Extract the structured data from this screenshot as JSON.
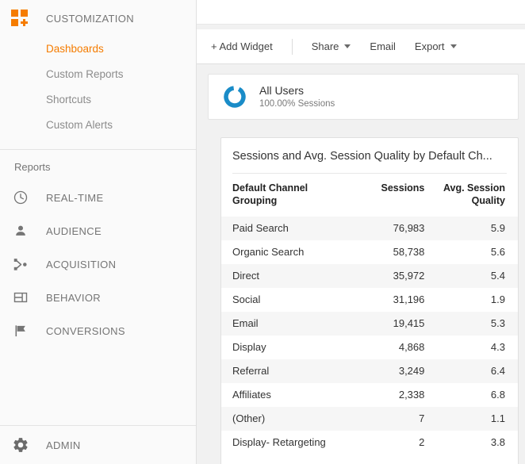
{
  "sidebar": {
    "customization": {
      "label": "CUSTOMIZATION",
      "icon": "customization-grid-icon"
    },
    "sub_items": [
      {
        "label": "Dashboards",
        "active": true
      },
      {
        "label": "Custom Reports",
        "active": false
      },
      {
        "label": "Shortcuts",
        "active": false
      },
      {
        "label": "Custom Alerts",
        "active": false
      }
    ],
    "reports_label": "Reports",
    "nav_items": [
      {
        "label": "REAL-TIME",
        "icon": "clock-icon"
      },
      {
        "label": "AUDIENCE",
        "icon": "person-icon"
      },
      {
        "label": "ACQUISITION",
        "icon": "share-network-icon"
      },
      {
        "label": "BEHAVIOR",
        "icon": "layout-panels-icon"
      },
      {
        "label": "CONVERSIONS",
        "icon": "flag-icon"
      }
    ],
    "admin": {
      "label": "ADMIN",
      "icon": "gear-icon"
    }
  },
  "toolbar": {
    "add_widget": "+ Add Widget",
    "share": "Share",
    "email": "Email",
    "export": "Export"
  },
  "segment": {
    "title": "All Users",
    "subtitle": "100.00% Sessions",
    "donut_color": "#1a8cc8"
  },
  "widget": {
    "title": "Sessions and Avg. Session Quality by Default Ch...",
    "columns": [
      "Default Channel Grouping",
      "Sessions",
      "Avg. Session Quality"
    ],
    "rows": [
      {
        "channel": "Paid Search",
        "sessions": "76,983",
        "quality": "5.9"
      },
      {
        "channel": "Organic Search",
        "sessions": "58,738",
        "quality": "5.6"
      },
      {
        "channel": "Direct",
        "sessions": "35,972",
        "quality": "5.4"
      },
      {
        "channel": "Social",
        "sessions": "31,196",
        "quality": "1.9"
      },
      {
        "channel": "Email",
        "sessions": "19,415",
        "quality": "5.3"
      },
      {
        "channel": "Display",
        "sessions": "4,868",
        "quality": "4.3"
      },
      {
        "channel": "Referral",
        "sessions": "3,249",
        "quality": "6.4"
      },
      {
        "channel": "Affiliates",
        "sessions": "2,338",
        "quality": "6.8"
      },
      {
        "channel": "(Other)",
        "sessions": "7",
        "quality": "1.1"
      },
      {
        "channel": "Display- Retargeting",
        "sessions": "2",
        "quality": "3.8"
      }
    ]
  },
  "colors": {
    "accent_orange": "#f57c00",
    "sidebar_bg": "#fafafa",
    "page_bg": "#f1f1f1",
    "text_gray": "#757575"
  }
}
